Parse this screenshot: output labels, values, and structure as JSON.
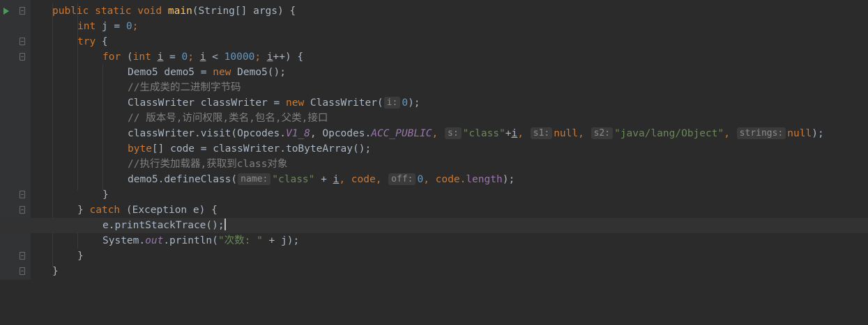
{
  "lines": {
    "l1": {
      "kw1": "public static void ",
      "fn": "main",
      "rest": "(String[] args) {"
    },
    "l2": {
      "kw": "int ",
      "a": "j = ",
      "num": "0",
      "semi": ";"
    },
    "l3": {
      "kw": "try ",
      "brace": "{"
    },
    "l4": {
      "kw1": "for ",
      "p1": "(",
      "kw2": "int ",
      "v1": "i",
      "p2": " = ",
      "n1": "0",
      "p3": "; ",
      "v2": "i",
      "p4": " < ",
      "n2": "10000",
      "p5": "; ",
      "v3": "i",
      "p6": "++) {"
    },
    "l5": {
      "a": "Demo5 demo5 = ",
      "kw": "new ",
      "b": "Demo5();"
    },
    "l6": {
      "cmt": "//生成类的二进制字节码"
    },
    "l7": {
      "a": "ClassWriter classWriter = ",
      "kw": "new ",
      "b": "ClassWriter(",
      "hint": "i:",
      "num": "0",
      "c": ");"
    },
    "l8": {
      "cmt": "// 版本号,访问权限,类名,包名,父类,接口"
    },
    "l9": {
      "a": "classWriter.visit(Opcodes.",
      "f1": "V1_8",
      "b": ", Opcodes.",
      "f2": "ACC_PUBLIC",
      "c": ", ",
      "h1": "s:",
      "s1": "\"class\"",
      "d": "+",
      "v": "i",
      "e": ", ",
      "h2": "s1:",
      "kw1": "null",
      "f": ", ",
      "h3": "s2:",
      "s2": "\"java/lang/Object\"",
      "g": ", ",
      "h4": "strings:",
      "kw2": "null",
      "h": ");"
    },
    "l10": {
      "kw": "byte",
      "a": "[] code = classWriter.toByteArray();"
    },
    "l11": {
      "cmt": "//执行类加载器,获取到class对象"
    },
    "l12": {
      "a": "demo5.defineClass(",
      "h1": "name:",
      "s": "\"class\"",
      "b": " + ",
      "v": "i",
      "c": ", code, ",
      "h2": "off:",
      "num": "0",
      "d": ", code.",
      "m": "length",
      "e": ");"
    },
    "l13": {
      "brace": "}"
    },
    "l14": {
      "a": "} ",
      "kw": "catch ",
      "b": "(Exception e) {"
    },
    "l15": {
      "a": "e.printStackTrace();"
    },
    "l16": {
      "a": "System.",
      "f": "out",
      "b": ".println(",
      "s": "\"次数: \"",
      "c": " + j);"
    },
    "l17": {
      "brace": "}"
    },
    "l18": {
      "brace": "}"
    }
  }
}
